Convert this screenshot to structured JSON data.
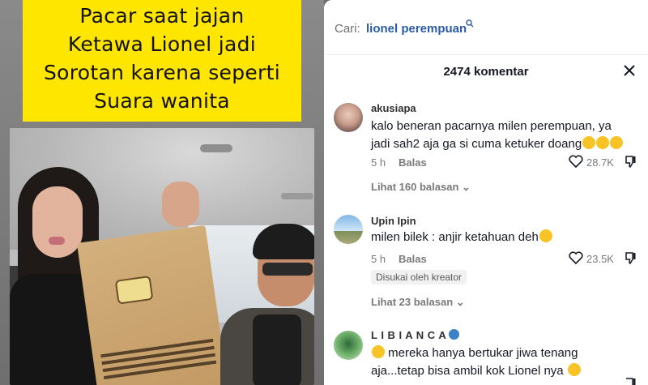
{
  "video": {
    "caption_lines": [
      "Pacar saat jajan",
      "Ketawa Lionel jadi",
      "Sorotan karena seperti",
      "Suara wanita"
    ],
    "caption_bg": "#ffe600"
  },
  "search": {
    "prefix": "Cari:",
    "query": "lionel perempuan",
    "icon": "search-icon"
  },
  "comments_header": {
    "count_label": "2474 komentar",
    "close_icon": "close-icon"
  },
  "comments": [
    {
      "username": "akusiapa",
      "text": "kalo beneran pacarnya milen perempuan, ya jadi sah2 aja ga si cuma ketuker doang",
      "time": "5 h",
      "reply_label": "Balas",
      "likes": "28.7K",
      "view_replies": "Lihat 160 balasan"
    },
    {
      "username": "Upin Ipin",
      "text": "milen bilek : anjir ketahuan deh",
      "time": "5 h",
      "reply_label": "Balas",
      "likes": "23.5K",
      "badge": "Disukai oleh kreator",
      "view_replies": "Lihat 23 balasan"
    },
    {
      "username": "L I B I A N C A",
      "text": "mereka hanya bertukar jiwa tenang aja...tetap bisa ambil kok Lionel nya"
    }
  ],
  "colors": {
    "query_link": "#2b5ba8",
    "muted": "#7a7a7a",
    "emoji": "#f7c325",
    "verified": "#3b82c4"
  }
}
